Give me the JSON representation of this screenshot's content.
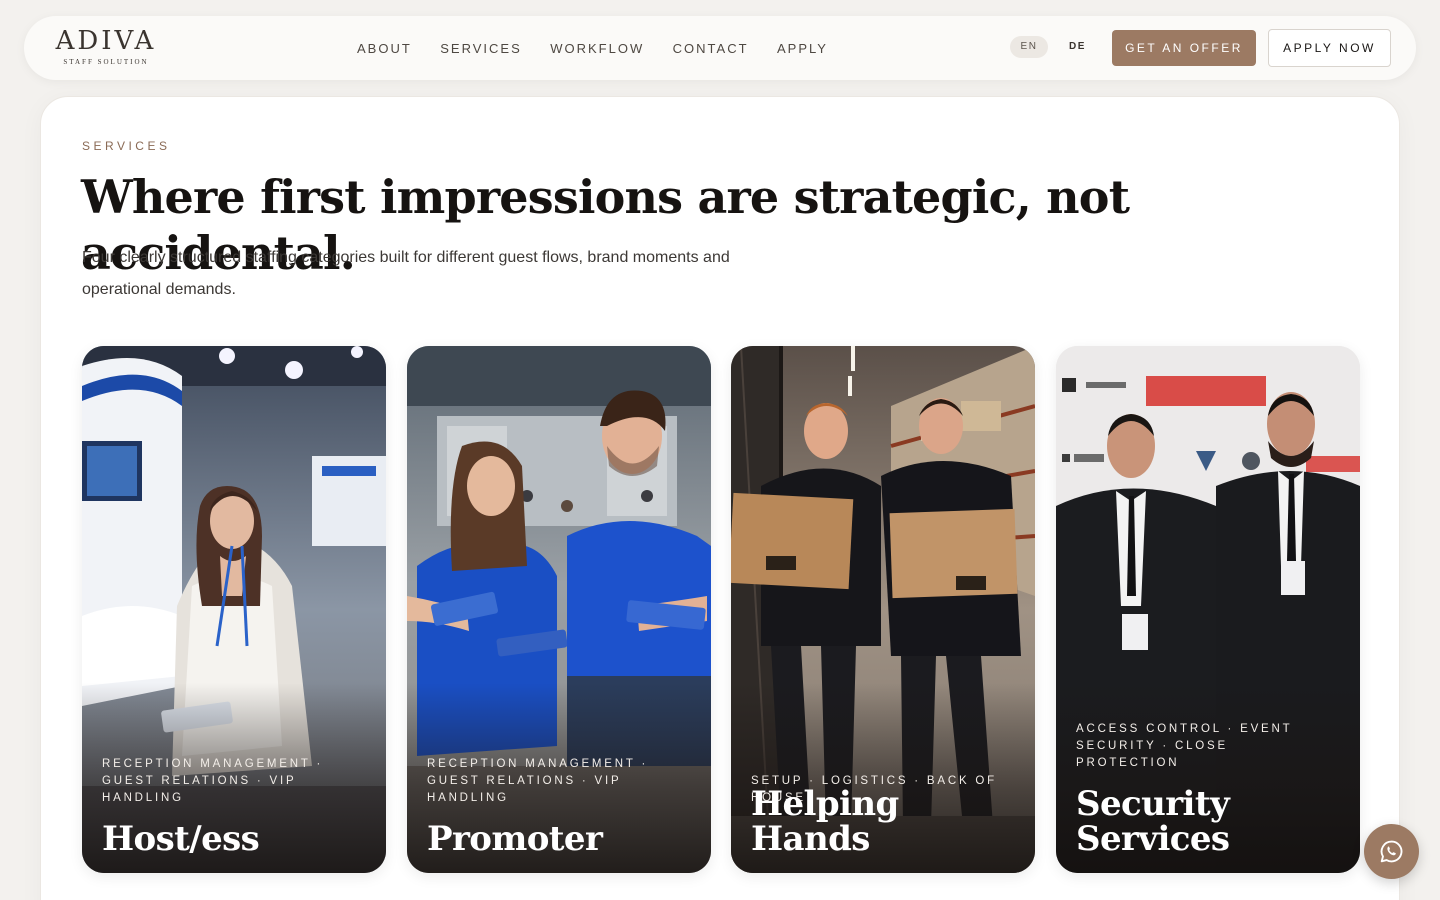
{
  "brand": {
    "name": "ADIVA",
    "tagline": "STAFF SOLUTION"
  },
  "nav": {
    "items": [
      {
        "label": "ABOUT"
      },
      {
        "label": "SERVICES"
      },
      {
        "label": "WORKFLOW"
      },
      {
        "label": "CONTACT"
      },
      {
        "label": "APPLY"
      }
    ]
  },
  "language": {
    "options": [
      "EN",
      "DE"
    ],
    "selected": "EN"
  },
  "actions": {
    "offer_label": "GET AN OFFER",
    "apply_label": "APPLY NOW"
  },
  "colors": {
    "accent": "#9c7a63",
    "eyebrow": "#8a6a55",
    "background": "#f3f1ee"
  },
  "services": {
    "eyebrow": "SERVICES",
    "headline": "Where first impressions are strategic, not accidental.",
    "intro": "Four clearly structured staffing categories built for different guest flows, brand moments and operational demands.",
    "cards": [
      {
        "tags": "RECEPTION MANAGEMENT · GUEST RELATIONS · VIP HANDLING",
        "title": "Host/ess"
      },
      {
        "tags": "RECEPTION MANAGEMENT · GUEST RELATIONS · VIP HANDLING",
        "title": "Promoter"
      },
      {
        "tags": "SETUP · LOGISTICS · BACK OF HOUSE",
        "title": "Helping Hands"
      },
      {
        "tags": "ACCESS CONTROL · EVENT SECURITY · CLOSE PROTECTION",
        "title": "Security Services"
      }
    ]
  },
  "chat": {
    "icon": "whatsapp-icon"
  }
}
